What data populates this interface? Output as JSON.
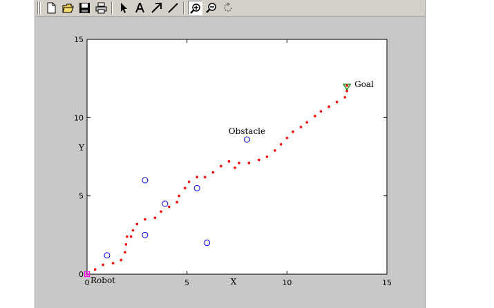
{
  "toolbar": {
    "buttons": [
      {
        "name": "new-figure-button",
        "icon": "new-file-icon"
      },
      {
        "name": "open-file-button",
        "icon": "folder-icon"
      },
      {
        "name": "save-button",
        "icon": "floppy-disk-icon"
      },
      {
        "name": "print-button",
        "icon": "printer-icon"
      },
      {
        "name": "edit-plot-button",
        "icon": "pointer-arrow-icon"
      },
      {
        "name": "insert-text-button",
        "icon": "text-icon"
      },
      {
        "name": "insert-arrow-button",
        "icon": "arrow-icon"
      },
      {
        "name": "insert-line-button",
        "icon": "line-icon"
      },
      {
        "name": "zoom-in-button",
        "icon": "zoom-in-icon",
        "pressed": true
      },
      {
        "name": "zoom-out-button",
        "icon": "zoom-out-icon"
      },
      {
        "name": "rotate-3d-button",
        "icon": "rotate-icon"
      }
    ]
  },
  "chart_data": {
    "type": "scatter",
    "title": "",
    "xlabel": "X",
    "ylabel": "Y",
    "xlim": [
      0,
      15
    ],
    "ylim": [
      0,
      15
    ],
    "xticks": [
      0,
      5,
      10,
      15
    ],
    "yticks": [
      0,
      5,
      10,
      15
    ],
    "grid": false,
    "path_color": "#ff0000",
    "obstacle_color": "#0000ff",
    "robot_color": "#ff00ff",
    "goal_color": "#008000",
    "annotations": [
      {
        "text": "Robot",
        "x": 0,
        "y": 0
      },
      {
        "text": "Obstacle",
        "x": 8.0,
        "y": 8.6
      },
      {
        "text": "Goal",
        "x": 13.0,
        "y": 12.0
      }
    ],
    "robot": {
      "x": 0,
      "y": 0
    },
    "goal": {
      "x": 13.0,
      "y": 12.0
    },
    "obstacles": [
      {
        "x": 1.0,
        "y": 1.2
      },
      {
        "x": 2.9,
        "y": 6.0
      },
      {
        "x": 2.9,
        "y": 2.5
      },
      {
        "x": 3.9,
        "y": 4.5
      },
      {
        "x": 5.5,
        "y": 5.5
      },
      {
        "x": 6.0,
        "y": 2.0
      },
      {
        "x": 8.0,
        "y": 8.6
      }
    ],
    "path": [
      [
        0.0,
        0.0
      ],
      [
        0.4,
        0.3
      ],
      [
        0.8,
        0.6
      ],
      [
        1.3,
        0.7
      ],
      [
        1.7,
        0.9
      ],
      [
        1.9,
        1.4
      ],
      [
        1.95,
        1.9
      ],
      [
        2.0,
        2.4
      ],
      [
        2.2,
        2.4
      ],
      [
        2.3,
        2.8
      ],
      [
        2.5,
        3.2
      ],
      [
        2.9,
        3.5
      ],
      [
        3.4,
        3.6
      ],
      [
        3.7,
        4.0
      ],
      [
        4.1,
        4.3
      ],
      [
        4.5,
        4.6
      ],
      [
        4.6,
        5.0
      ],
      [
        4.9,
        5.5
      ],
      [
        5.1,
        5.9
      ],
      [
        5.5,
        6.2
      ],
      [
        5.9,
        6.2
      ],
      [
        6.3,
        6.5
      ],
      [
        6.7,
        6.9
      ],
      [
        7.1,
        7.2
      ],
      [
        7.4,
        6.8
      ],
      [
        7.6,
        7.1
      ],
      [
        8.1,
        7.1
      ],
      [
        8.6,
        7.3
      ],
      [
        9.0,
        7.5
      ],
      [
        9.4,
        7.9
      ],
      [
        9.7,
        8.3
      ],
      [
        10.0,
        8.7
      ],
      [
        10.3,
        9.1
      ],
      [
        10.7,
        9.4
      ],
      [
        11.0,
        9.7
      ],
      [
        11.4,
        10.1
      ],
      [
        11.7,
        10.4
      ],
      [
        12.1,
        10.7
      ],
      [
        12.5,
        11.0
      ],
      [
        12.9,
        11.3
      ],
      [
        13.0,
        11.7
      ]
    ]
  }
}
